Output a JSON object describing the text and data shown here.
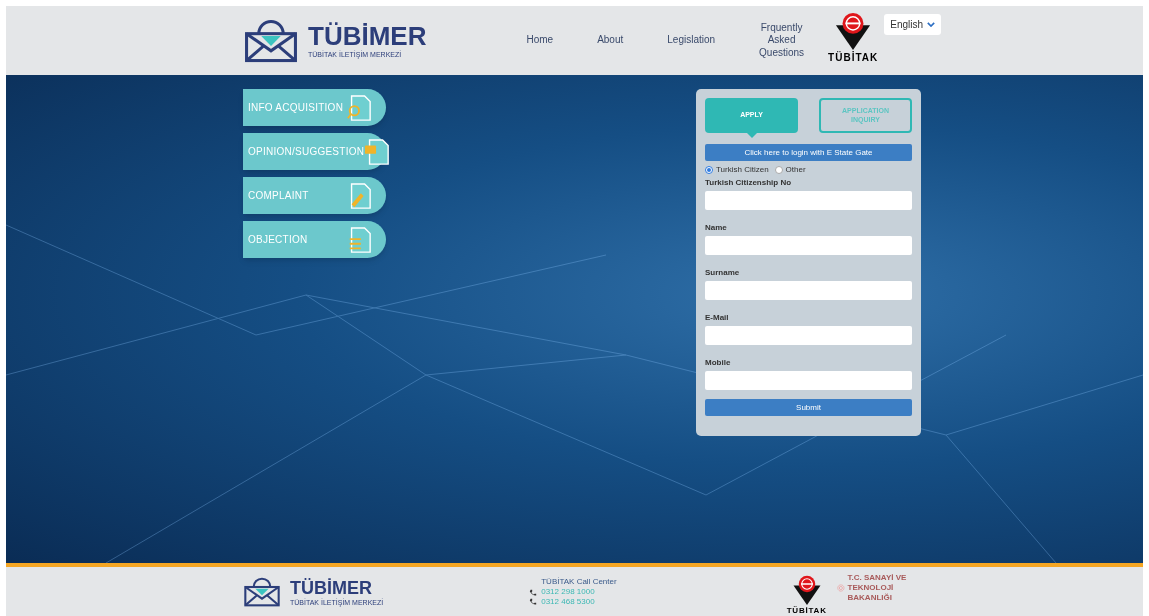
{
  "header": {
    "logo": {
      "title": "TÜBİMER",
      "subtitle": "TÜBİTAK İLETİŞİM MERKEZİ"
    },
    "nav": [
      {
        "label": "Home"
      },
      {
        "label": "About"
      },
      {
        "label": "Legislation"
      },
      {
        "label": "Frquently Asked Questions"
      }
    ],
    "partner_logo": "TÜBİTAK",
    "language": "English"
  },
  "categories": [
    {
      "label": "INFO ACQUISITION"
    },
    {
      "label": "OPINION/SUGGESTION"
    },
    {
      "label": "COMPLAINT"
    },
    {
      "label": "OBJECTION"
    }
  ],
  "form": {
    "tabs": [
      {
        "label": "APPLY",
        "selected": true
      },
      {
        "label": "APPLICATION INQUIRY",
        "selected": false
      }
    ],
    "login_button": "Click here to login with E State Gate",
    "citizenship": [
      {
        "label": "Turkish Citizen",
        "selected": true
      },
      {
        "label": "Other",
        "selected": false
      }
    ],
    "fields": [
      {
        "label": "Turkish Citizenship No"
      },
      {
        "label": "Name"
      },
      {
        "label": "Surname"
      },
      {
        "label": "E-Mail"
      },
      {
        "label": "Mobile"
      }
    ],
    "submit": "Submit"
  },
  "footer": {
    "logo": {
      "title": "TÜBİMER",
      "subtitle": "TÜBİTAK İLETİŞİM MERKEZİ"
    },
    "call_center": "TÜBİTAK Call Center",
    "phones": [
      "0312 298 1000",
      "0312 468 5300"
    ],
    "partner_logo": "TÜBİTAK",
    "ministry": "T.C. SANAYİ VE TEKNOLOJİ BAKANLIĞI"
  }
}
